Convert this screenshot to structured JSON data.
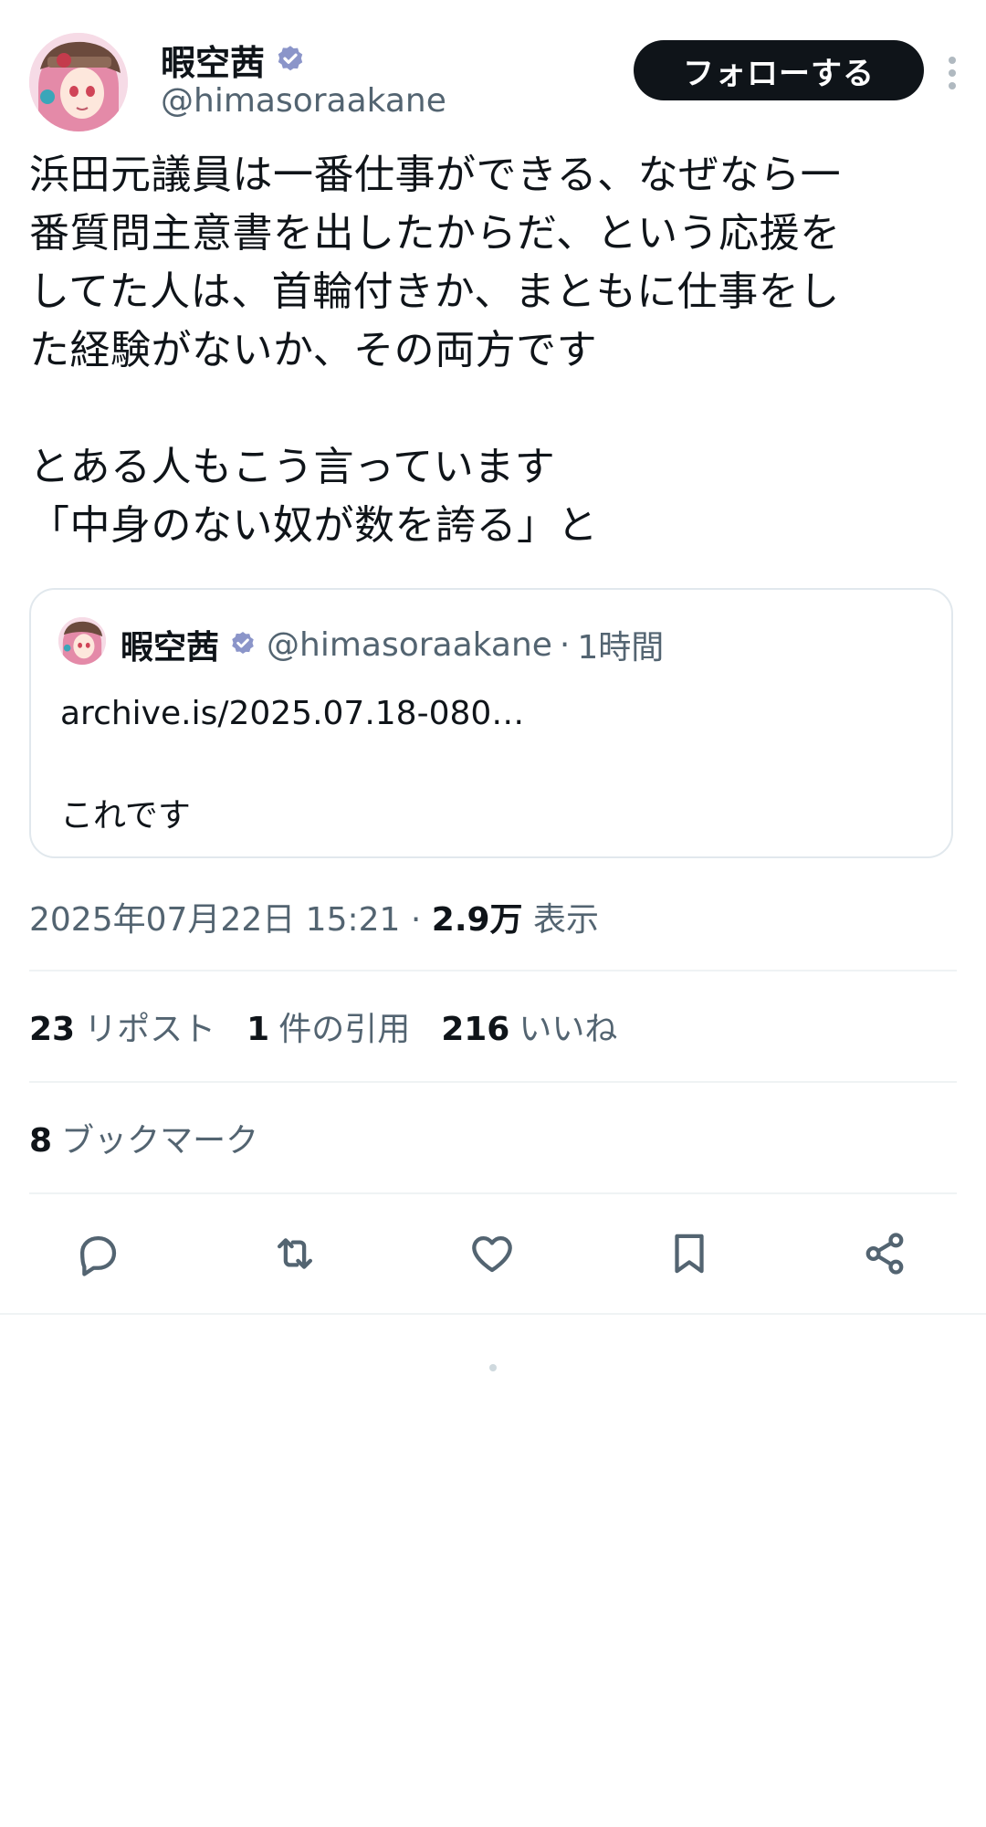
{
  "author": {
    "display_name": "暇空茜",
    "handle": "@himasoraakane",
    "follow_label": "フォローする"
  },
  "tweet": {
    "text": "浜田元議員は一番仕事ができる、なぜなら一\n番質問主意書を出したからだ、という応援を\nしてた人は、首輪付きか、まともに仕事をし\nた経験がないか、その両方です\n\nとある人もこう言っています\n「中身のない奴が数を誇る」と"
  },
  "quote": {
    "display_name": "暇空茜",
    "handle": "@himasoraakane",
    "separator": "·",
    "time": "1時間",
    "body": "archive.is/2025.07.18-080…\n\nこれです"
  },
  "meta": {
    "timestamp": "2025年07月22日 15:21",
    "separator": " · ",
    "views_count": "2.9万",
    "views_label": "表示"
  },
  "stats": {
    "reposts_count": "23",
    "reposts_label": "リポスト",
    "quotes_count": "1",
    "quotes_label": "件の引用",
    "likes_count": "216",
    "likes_label": "いいね",
    "bookmarks_count": "8",
    "bookmarks_label": "ブックマーク"
  },
  "icons": {
    "reply": "reply-icon",
    "repost": "repost-icon",
    "like": "heart-icon",
    "bookmark": "bookmark-icon",
    "share": "share-icon",
    "more": "more-vertical-icon",
    "verified": "verified-badge-icon"
  },
  "colors": {
    "text_primary": "#0f1419",
    "text_secondary": "#536471",
    "verified": "#8b95c9",
    "follow_bg": "#0f1419",
    "divider": "#eff3f4"
  }
}
